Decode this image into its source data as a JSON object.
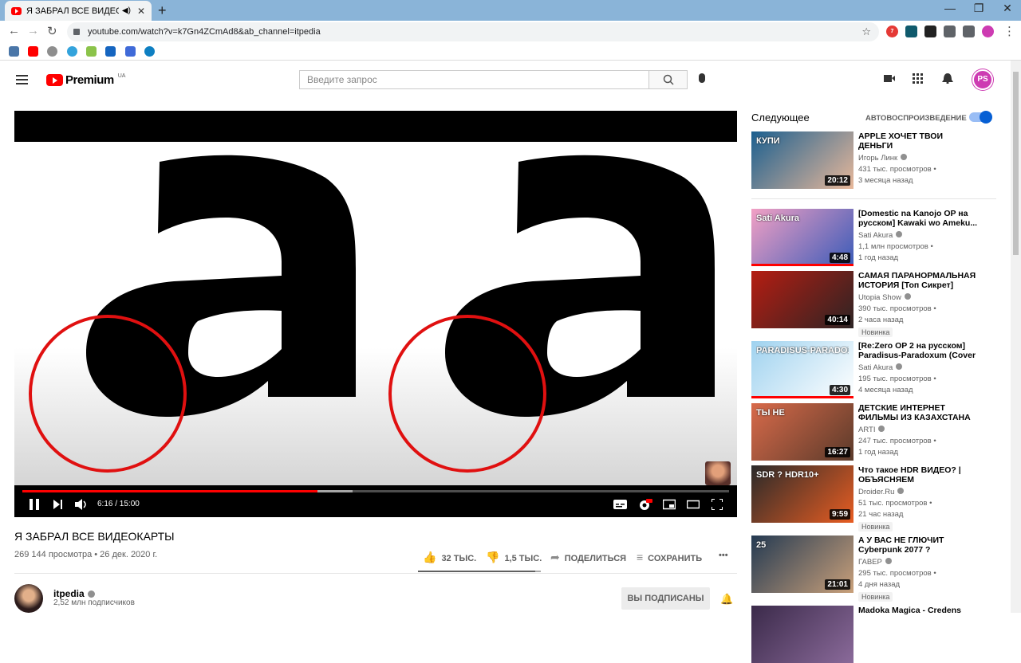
{
  "browser": {
    "tab_title": "Я ЗАБРАЛ ВСЕ ВИДЕОКАРТЫ",
    "new_tab": "+",
    "url": "youtube.com/watch?v=k7Gn4ZCmAd8&ab_channel=itpedia",
    "window_controls": [
      "—",
      "❐",
      "✕"
    ],
    "ext_badge": "7"
  },
  "youtube": {
    "logo_text": "Premium",
    "country_code": "UA",
    "search_placeholder": "Введите запрос",
    "avatar_initials": "PS"
  },
  "player": {
    "time": "6:16 / 15:00",
    "progress_played": 0.418,
    "progress_buffered": 0.467
  },
  "video": {
    "title": "Я ЗАБРАЛ ВСЕ ВИДЕОКАРТЫ",
    "meta": "269 144 просмотра • 26 дек. 2020 г.",
    "likes": "32 ТЫС.",
    "dislikes": "1,5 ТЫС.",
    "like_ratio": 0.955,
    "share": "ПОДЕЛИТЬСЯ",
    "save": "СОХРАНИТЬ",
    "more": "•••",
    "channel": "itpedia",
    "subscribers": "2,52 млн подписчиков",
    "subscribed_label": "ВЫ ПОДПИСАНЫ"
  },
  "sidebar": {
    "next_label": "Следующее",
    "autoplay_label": "АВТОВОСПРОИЗВЕДЕНИЕ",
    "items": [
      {
        "title": "APPLE ХОЧЕТ ТВОИ ДЕНЬГИ",
        "channel": "Игорь Линк",
        "views": "431 тыс. просмотров •",
        "age": "3 месяца назад",
        "duration": "20:12",
        "badge": "",
        "thumb_label": "КУПИ",
        "color_a": "#1b5f8f",
        "color_b": "#e8b89a"
      },
      {
        "title": "[Domestic na Kanojo OP на русском] Kawaki wo Ameku...",
        "channel": "Sati Akura",
        "views": "1,1 млн просмотров •",
        "age": "1 год назад",
        "duration": "4:48",
        "badge": "",
        "thumb_label": "Sati Akura",
        "color_a": "#f2a0c4",
        "color_b": "#3a5bb8"
      },
      {
        "title": "САМАЯ ПАРАНОРМАЛЬНАЯ ИСТОРИЯ [Топ Сикрет]",
        "channel": "Utopia Show",
        "views": "390 тыс. просмотров •",
        "age": "2 часа назад",
        "duration": "40:14",
        "badge": "Новинка",
        "thumb_label": "",
        "color_a": "#b51d12",
        "color_b": "#2d2424"
      },
      {
        "title": "[Re:Zero OP 2 на русском] Paradisus-Paradoxum (Cover ...",
        "channel": "Sati Akura",
        "views": "195 тыс. просмотров •",
        "age": "4 месяца назад",
        "duration": "4:30",
        "badge": "",
        "thumb_label": "PARADISUS-PARADOXUM",
        "color_a": "#9fd2ef",
        "color_b": "#ffffff"
      },
      {
        "title": "ДЕТСКИЕ ИНТЕРНЕТ ФИЛЬМЫ ИЗ КАЗАХСТАНА",
        "channel": "ARTI",
        "views": "247 тыс. просмотров •",
        "age": "1 год назад",
        "duration": "16:27",
        "badge": "",
        "thumb_label": "ТЫ НЕ",
        "color_a": "#d86a4a",
        "color_b": "#5a3a2a"
      },
      {
        "title": "Что такое HDR ВИДЕО? | ОБЪЯСНЯЕМ",
        "channel": "Droider.Ru",
        "views": "51 тыс. просмотров •",
        "age": "21 час назад",
        "duration": "9:59",
        "badge": "Новинка",
        "thumb_label": "SDR ? HDR10+",
        "color_a": "#2a2a2a",
        "color_b": "#e85d22"
      },
      {
        "title": "А У ВАС НЕ ГЛЮЧИТ Cyberpunk 2077 ?",
        "channel": "ГАВЕР",
        "views": "295 тыс. просмотров •",
        "age": "4 дня назад",
        "duration": "21:01",
        "badge": "Новинка",
        "thumb_label": "25",
        "color_a": "#243a52",
        "color_b": "#c9a07a"
      },
      {
        "title": "Madoka Magica - Credens",
        "channel": "",
        "views": "",
        "age": "",
        "duration": "",
        "badge": "",
        "thumb_label": "",
        "color_a": "#3b2a4a",
        "color_b": "#8a6a9a"
      }
    ]
  }
}
